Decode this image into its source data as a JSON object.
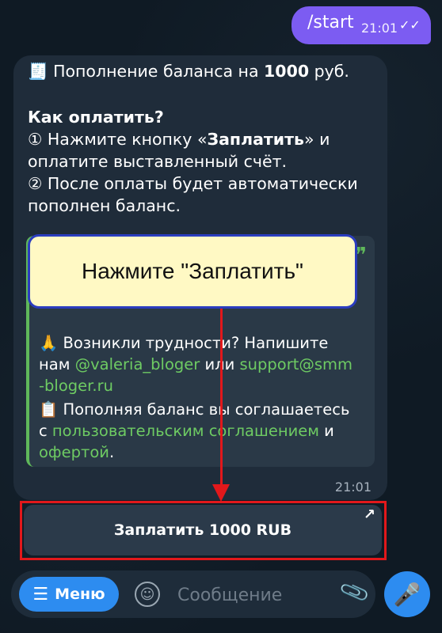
{
  "outgoing": {
    "text": "/start",
    "time": "21:01",
    "check": "✓✓"
  },
  "incoming": {
    "line1_emoji": "🧾",
    "line1_prefix": "Пополнение баланса на ",
    "line1_amount": "1000",
    "line1_suffix": " руб.",
    "how_to_pay": "Как оплатить?",
    "step1_prefix": "① Нажмите кнопку «",
    "step1_bold": "Заплатить",
    "step1_suffix": "» и",
    "step1_line2": "оплатите выставленный счёт.",
    "step2_line1": "② После оплаты будет автоматически",
    "step2_line2": "пополнен баланс.",
    "quote": {
      "mark": "❞",
      "q1_emoji": "🙏",
      "q1_text": " Возникли трудности? Напишите",
      "q2_prefix": "нам ",
      "q2_user": "@valeria_bloger",
      "q2_mid": " или ",
      "q2_support": "support@smm",
      "q3": "-bloger.ru",
      "q4_emoji": "📋",
      "q4_text": " Пополняя баланс вы соглашаетесь",
      "q5_prefix": "с ",
      "q5_link": "пользовательским соглашением",
      "q5_suffix": " и",
      "q6_link": "офертой",
      "q6_suffix": "."
    },
    "time": "21:01"
  },
  "tooltip": {
    "text": "Нажмите \"Заплатить\""
  },
  "pay_button": {
    "label": "Заплатить 1000 RUB",
    "arrow": "↗"
  },
  "input_bar": {
    "menu_label": "Меню",
    "menu_icon": "☰",
    "emoji_icon": "☺",
    "placeholder": "Сообщение",
    "attach_icon": "📎",
    "mic_icon": "🎤"
  },
  "colors": {
    "accent": "#2d8cf0",
    "outgoing_bubble": "#7c5cf2",
    "highlight": "#e2181b",
    "link": "#6ecb63"
  }
}
